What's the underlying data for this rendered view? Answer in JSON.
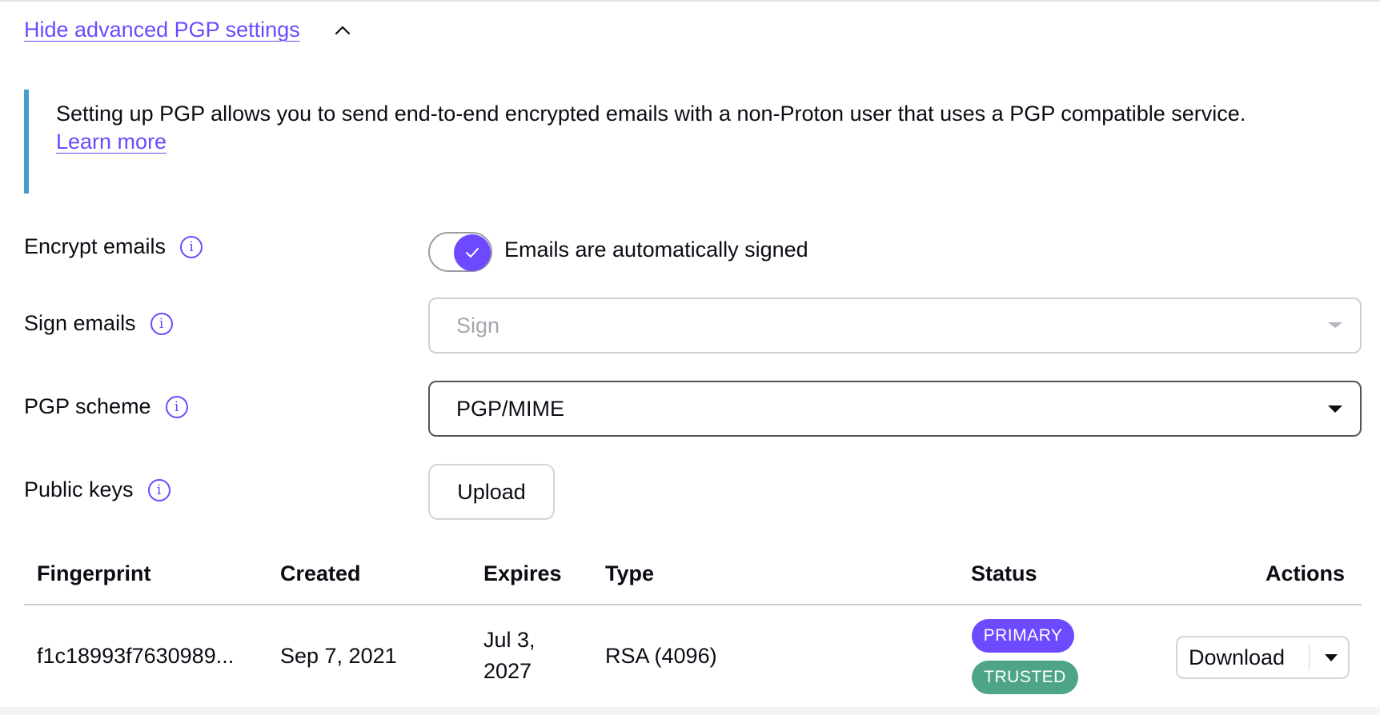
{
  "advanced": {
    "toggle_label": "Hide advanced PGP settings"
  },
  "info": {
    "text": "Setting up PGP allows you to send end-to-end encrypted emails with a non-Proton user that uses a PGP compatible service.",
    "link": "Learn more"
  },
  "encrypt": {
    "label": "Encrypt emails",
    "toggle_on": true,
    "toggle_text": "Emails are automatically signed"
  },
  "sign": {
    "label": "Sign emails",
    "placeholder": "Sign"
  },
  "scheme": {
    "label": "PGP scheme",
    "value": "PGP/MIME"
  },
  "public_keys": {
    "label": "Public keys",
    "upload_label": "Upload"
  },
  "table": {
    "headers": {
      "fingerprint": "Fingerprint",
      "created": "Created",
      "expires": "Expires",
      "type": "Type",
      "status": "Status",
      "actions": "Actions"
    },
    "rows": [
      {
        "fingerprint": "f1c18993f7630989...",
        "created": "Sep 7, 2021",
        "expires_line1": "Jul 3,",
        "expires_line2": "2027",
        "type": "RSA (4096)",
        "badges": [
          "PRIMARY",
          "TRUSTED"
        ],
        "action": "Download"
      }
    ]
  },
  "colors": {
    "accent": "#6d4aff",
    "trusted": "#4ea585",
    "info_border": "#4a9bd0"
  }
}
